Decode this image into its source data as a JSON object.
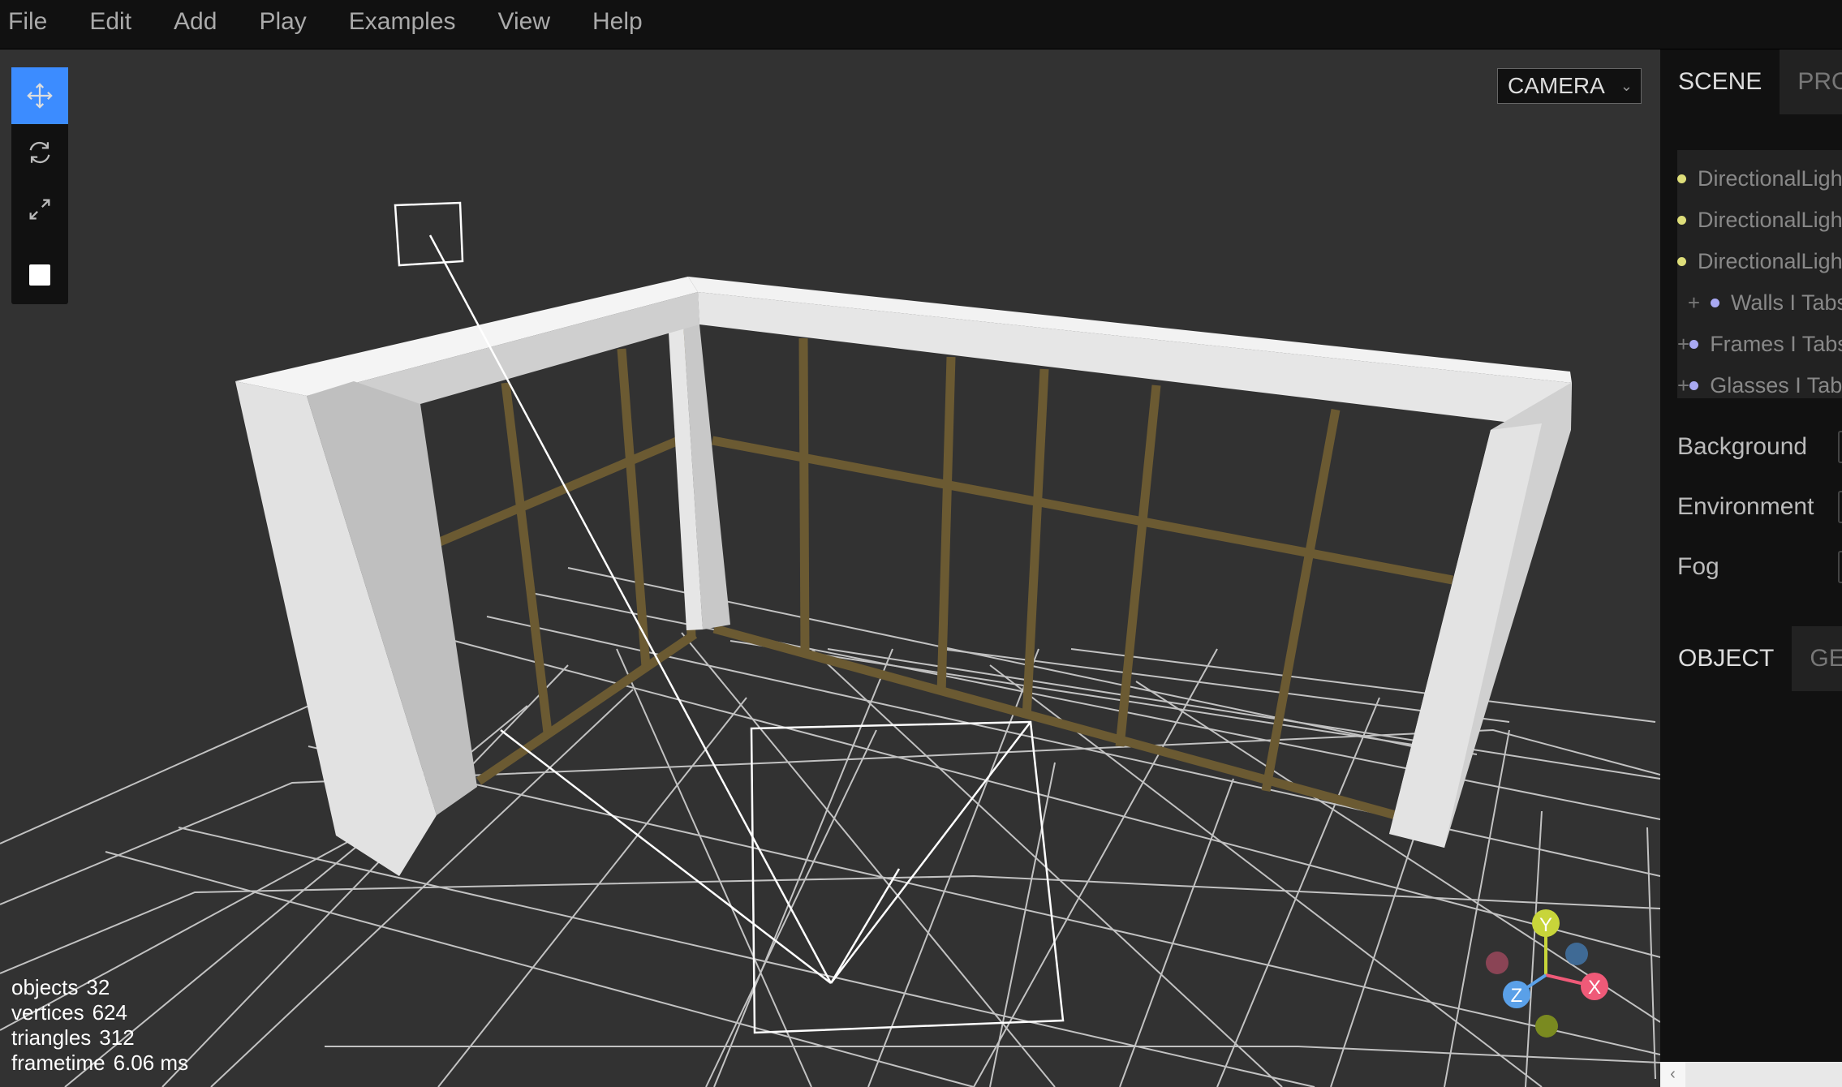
{
  "menubar": {
    "items": [
      "File",
      "Edit",
      "Add",
      "Play",
      "Examples",
      "View",
      "Help"
    ]
  },
  "viewport": {
    "camera_select": "CAMERA",
    "info": {
      "objects_label": "objects",
      "objects": "32",
      "vertices_label": "vertices",
      "vertices": "624",
      "triangles_label": "triangles",
      "triangles": "312",
      "frametime_label": "frametime",
      "frametime": "6.06 ms"
    },
    "gizmo": {
      "x": "X",
      "y": "Y",
      "z": "Z"
    }
  },
  "toolbar": {
    "tools": [
      "translate-icon",
      "rotate-icon",
      "scale-icon"
    ],
    "active": "translate-icon"
  },
  "sidebar": {
    "tabs": [
      "SCENE",
      "PROJECT"
    ],
    "outliner": [
      {
        "label": "DirectionalLight",
        "opener": "",
        "color": "#dede7a"
      },
      {
        "label": "DirectionalLight",
        "opener": "",
        "color": "#dede7a"
      },
      {
        "label": "DirectionalLight",
        "opener": "",
        "color": "#dede7a"
      },
      {
        "label": "Walls I Tabs",
        "opener": "+",
        "color": "#a9a9f2"
      },
      {
        "label": "Frames I Tabs",
        "opener": "+",
        "color": "#a9a9f2"
      },
      {
        "label": "Glasses I Tabs",
        "opener": "+",
        "color": "#a9a9f2"
      }
    ],
    "background_label": "Background",
    "environment_label": "Environment",
    "fog_label": "Fog",
    "object_tabs": [
      "OBJECT",
      "GEOMETRY"
    ]
  },
  "colors": {
    "accent": "#3c8cff",
    "wall": "#d9d9d9",
    "frame": "#6b5a32",
    "grid": "#e0e0e0",
    "axis_x": "#ef5a78",
    "axis_y": "#c8d53a",
    "axis_z": "#5aa0e8"
  }
}
